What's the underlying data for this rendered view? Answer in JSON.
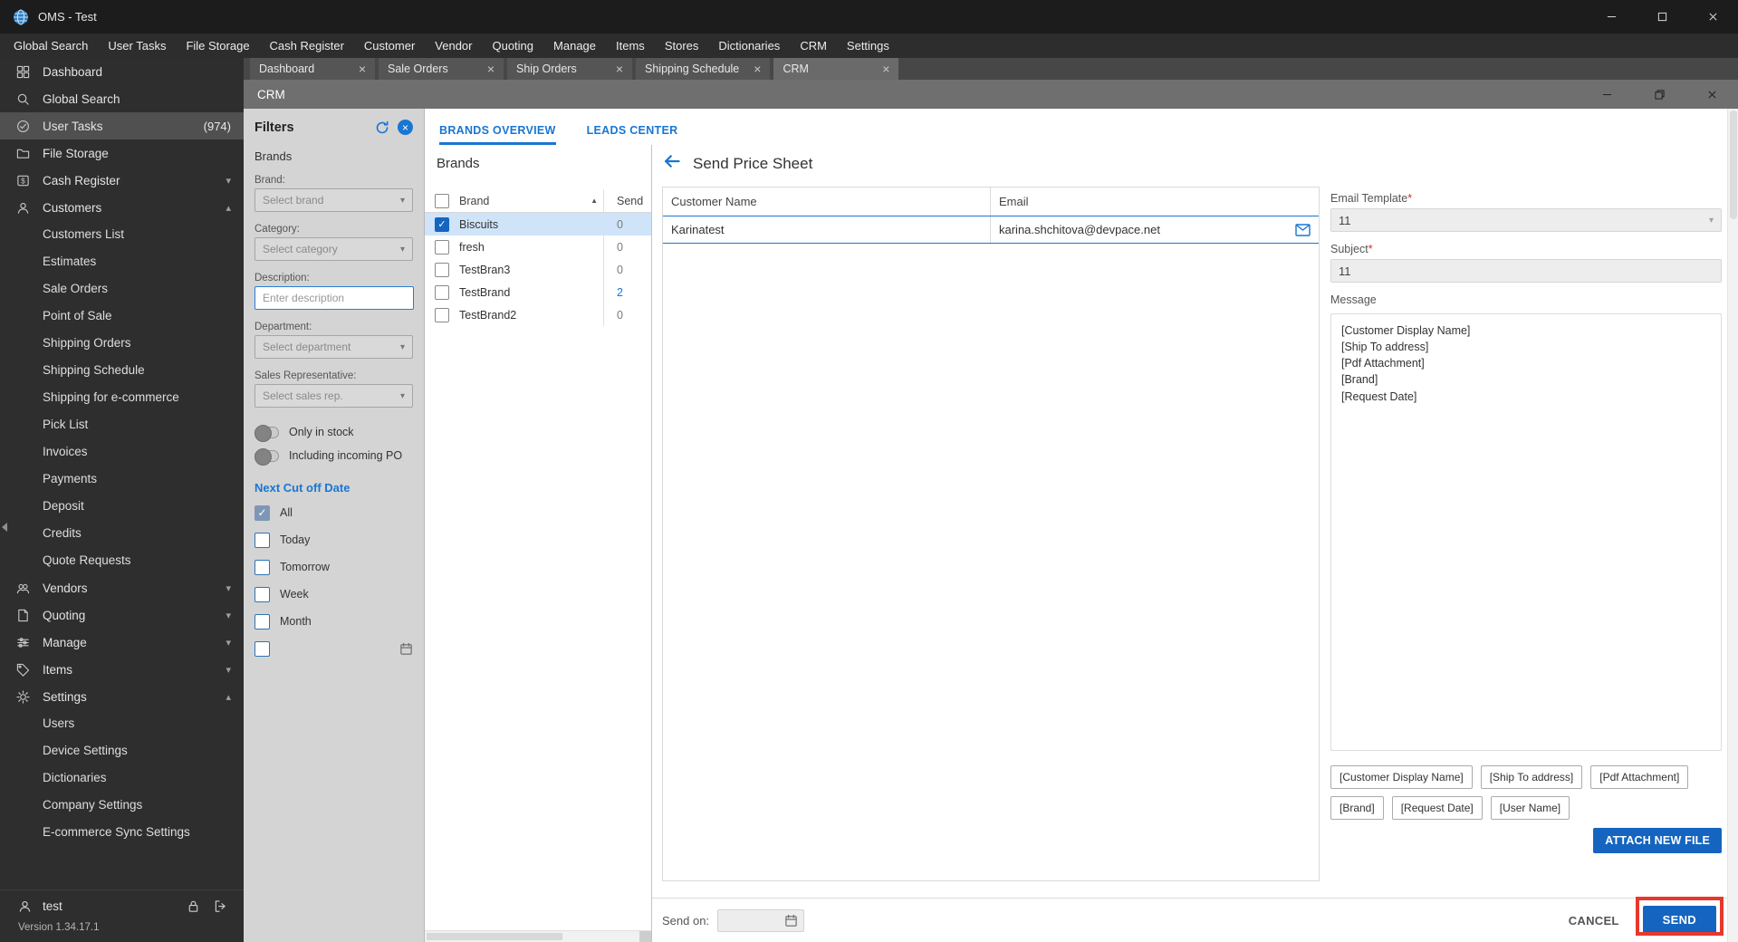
{
  "titlebar": {
    "title": "OMS - Test"
  },
  "menubar": {
    "items": [
      "Global Search",
      "User Tasks",
      "File Storage",
      "Cash Register",
      "Customer",
      "Vendor",
      "Quoting",
      "Manage",
      "Items",
      "Stores",
      "Dictionaries",
      "CRM",
      "Settings"
    ]
  },
  "sidebar": {
    "items": [
      {
        "label": "Dashboard"
      },
      {
        "label": "Global Search"
      },
      {
        "label": "User Tasks",
        "badge": "(974)"
      },
      {
        "label": "File Storage"
      },
      {
        "label": "Cash Register"
      },
      {
        "label": "Customers"
      },
      {
        "label": "Customers List"
      },
      {
        "label": "Estimates"
      },
      {
        "label": "Sale Orders"
      },
      {
        "label": "Point of Sale"
      },
      {
        "label": "Shipping Orders"
      },
      {
        "label": "Shipping Schedule"
      },
      {
        "label": "Shipping for e-commerce"
      },
      {
        "label": "Pick List"
      },
      {
        "label": "Invoices"
      },
      {
        "label": "Payments"
      },
      {
        "label": "Deposit"
      },
      {
        "label": "Credits"
      },
      {
        "label": "Quote Requests"
      },
      {
        "label": "Vendors"
      },
      {
        "label": "Quoting"
      },
      {
        "label": "Manage"
      },
      {
        "label": "Items"
      },
      {
        "label": "Settings"
      },
      {
        "label": "Users"
      },
      {
        "label": "Device Settings"
      },
      {
        "label": "Dictionaries"
      },
      {
        "label": "Company Settings"
      },
      {
        "label": "E-commerce Sync Settings"
      }
    ],
    "user": "test",
    "version": "Version 1.34.17.1"
  },
  "tabs": [
    {
      "label": "Dashboard"
    },
    {
      "label": "Sale Orders"
    },
    {
      "label": "Ship Orders"
    },
    {
      "label": "Shipping Schedule"
    },
    {
      "label": "CRM"
    }
  ],
  "crm": {
    "window_title": "CRM",
    "view_tabs": [
      {
        "label": "BRANDS OVERVIEW"
      },
      {
        "label": "LEADS CENTER"
      }
    ],
    "filters": {
      "title": "Filters",
      "section": "Brands",
      "brand_label": "Brand:",
      "brand_placeholder": "Select brand",
      "category_label": "Category:",
      "category_placeholder": "Select category",
      "description_label": "Description:",
      "description_placeholder": "Enter description",
      "department_label": "Department:",
      "department_placeholder": "Select department",
      "salesrep_label": "Sales Representative:",
      "salesrep_placeholder": "Select sales rep.",
      "toggle_stock": "Only in stock",
      "toggle_po": "Including incoming PO",
      "cutoff_title": "Next Cut off Date",
      "cutoff_options": [
        {
          "label": "All",
          "checked": true
        },
        {
          "label": "Today",
          "checked": false
        },
        {
          "label": "Tomorrow",
          "checked": false
        },
        {
          "label": "Week",
          "checked": false
        },
        {
          "label": "Month",
          "checked": false
        }
      ]
    },
    "brands": {
      "title": "Brands",
      "col_brand": "Brand",
      "col_send": "Send",
      "rows": [
        {
          "name": "Biscuits",
          "send": "0",
          "checked": true,
          "selected": true
        },
        {
          "name": "fresh",
          "send": "0",
          "checked": false,
          "selected": false
        },
        {
          "name": "TestBran3",
          "send": "0",
          "checked": false,
          "selected": false
        },
        {
          "name": "TestBrand",
          "send": "2",
          "checked": false,
          "selected": false
        },
        {
          "name": "TestBrand2",
          "send": "0",
          "checked": false,
          "selected": false
        }
      ]
    },
    "sheet": {
      "title": "Send Price Sheet",
      "col_customer": "Customer Name",
      "col_email": "Email",
      "rows": [
        {
          "customer": "Karinatest",
          "email": "karina.shchitova@devpace.net"
        }
      ],
      "required_mark": "*",
      "email_template_label": "Email Template",
      "email_template_value": "11",
      "subject_label": "Subject",
      "subject_value": "11",
      "message_label": "Message",
      "message_value": "[Customer Display Name]\n[Ship To address]\n[Pdf Attachment]\n[Brand]\n[Request Date]",
      "tokens": [
        "[Customer Display Name]",
        "[Ship To address]",
        "[Pdf Attachment]",
        "[Brand]",
        "[Request Date]",
        "[User Name]"
      ],
      "attach_button": "ATTACH NEW FILE",
      "send_on_label": "Send on:",
      "cancel_button": "CANCEL",
      "send_button": "SEND"
    }
  },
  "colors": {
    "accent_blue": "#1565c0",
    "link_blue": "#1976d2",
    "annotation_red": "#e8382c",
    "selected_row": "#cfe4f8"
  }
}
